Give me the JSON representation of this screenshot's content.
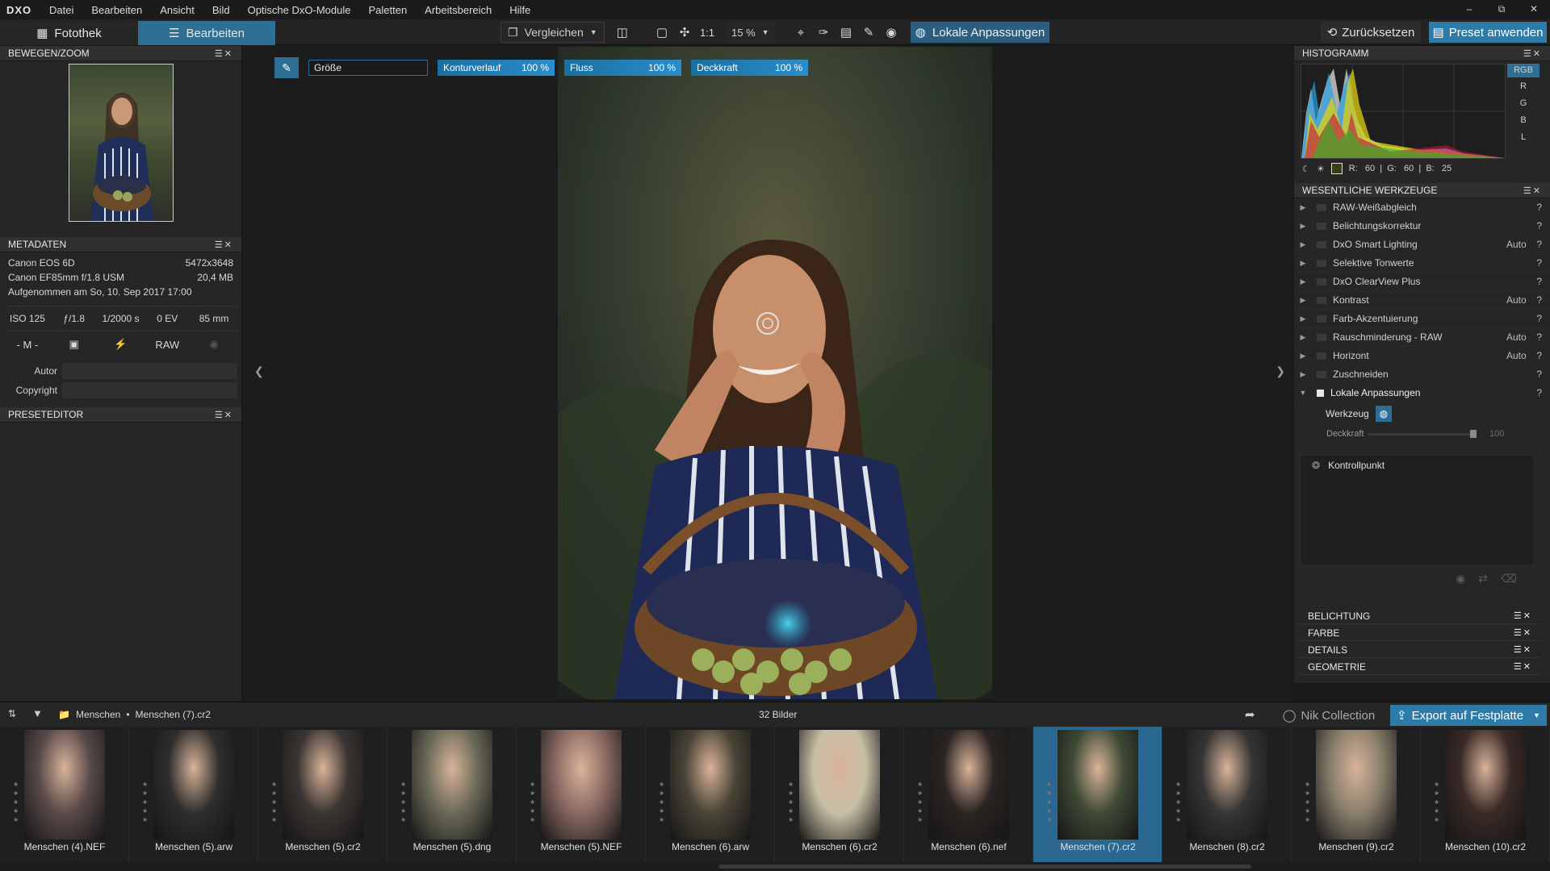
{
  "app": {
    "logo": "DXO"
  },
  "menu": [
    "Datei",
    "Bearbeiten",
    "Ansicht",
    "Bild",
    "Optische DxO-Module",
    "Paletten",
    "Arbeitsbereich",
    "Hilfe"
  ],
  "toolbar": {
    "tab_library": "Fotothek",
    "tab_edit": "Bearbeiten",
    "compare": "Vergleichen",
    "one_to_one": "1:1",
    "zoom": "15 %",
    "local_adjust": "Lokale Anpassungen",
    "reset": "Zurücksetzen",
    "apply_preset": "Preset anwenden"
  },
  "left": {
    "move_zoom_title": "BEWEGEN/ZOOM",
    "metadata_title": "METADATEN",
    "camera": "Canon EOS 6D",
    "resolution": "5472x3648",
    "lens": "Canon EF85mm f/1.8 USM",
    "filesize": "20,4 MB",
    "date": "Aufgenommen am So, 10. Sep 2017 17:00",
    "exif": [
      "ISO 125",
      "ƒ/1.8",
      "1/2000 s",
      "0 EV",
      "85 mm"
    ],
    "mode": "- M -",
    "raw": "RAW",
    "author_label": "Autor",
    "copyright_label": "Copyright",
    "preset_editor_title": "PRESETEDITOR"
  },
  "lokal_bar": {
    "size_label": "Größe",
    "sliders": [
      {
        "label": "Konturverlauf",
        "value": "100 %"
      },
      {
        "label": "Fluss",
        "value": "100 %"
      },
      {
        "label": "Deckkraft",
        "value": "100 %"
      }
    ]
  },
  "right": {
    "histogram_title": "HISTOGRAMM",
    "channels": [
      "RGB",
      "R",
      "G",
      "B",
      "L"
    ],
    "rgb_readout": "R:   60  |  G:   60  |  B:   25",
    "tools_title": "WESENTLICHE WERKZEUGE",
    "tools": [
      {
        "name": "RAW-Weißabgleich",
        "auto": "",
        "q": "?"
      },
      {
        "name": "Belichtungskorrektur",
        "auto": "",
        "q": "?"
      },
      {
        "name": "DxO Smart Lighting",
        "auto": "Auto",
        "q": "?"
      },
      {
        "name": "Selektive Tonwerte",
        "auto": "",
        "q": "?"
      },
      {
        "name": "DxO ClearView Plus",
        "auto": "",
        "q": "?"
      },
      {
        "name": "Kontrast",
        "auto": "Auto",
        "q": "?"
      },
      {
        "name": "Farb-Akzentuierung",
        "auto": "",
        "q": "?"
      },
      {
        "name": "Rauschminderung - RAW",
        "auto": "Auto",
        "q": "?"
      },
      {
        "name": "Horizont",
        "auto": "Auto",
        "q": "?"
      },
      {
        "name": "Zuschneiden",
        "auto": "",
        "q": "?"
      },
      {
        "name": "Lokale Anpassungen",
        "auto": "",
        "q": "?"
      }
    ],
    "werkzeug_label": "Werkzeug",
    "deckkraft_label": "Deckkraft",
    "deckkraft_value": "100",
    "kontrollpunkt": "Kontrollpunkt",
    "sections": [
      "BELICHTUNG",
      "FARBE",
      "DETAILS",
      "GEOMETRIE"
    ]
  },
  "filmstrip_bar": {
    "folder": "Menschen",
    "separator": "•",
    "file": "Menschen (7).cr2",
    "count": "32 Bilder",
    "nik": "Nik Collection",
    "export": "Export auf Festplatte"
  },
  "filmstrip": [
    {
      "name": "Menschen (4).NEF",
      "tone": "#5a4a4a"
    },
    {
      "name": "Menschen (5).arw",
      "tone": "#2e2e2e"
    },
    {
      "name": "Menschen (5).cr2",
      "tone": "#3a3532"
    },
    {
      "name": "Menschen (5).dng",
      "tone": "#6b6a58"
    },
    {
      "name": "Menschen (5).NEF",
      "tone": "#8a6a62"
    },
    {
      "name": "Menschen (6).arw",
      "tone": "#4a4436"
    },
    {
      "name": "Menschen (6).cr2",
      "tone": "#c8bfa6"
    },
    {
      "name": "Menschen (6).nef",
      "tone": "#2a2422"
    },
    {
      "name": "Menschen (7).cr2",
      "tone": "#3f4a35",
      "selected": true
    },
    {
      "name": "Menschen (8).cr2",
      "tone": "#353535"
    },
    {
      "name": "Menschen (9).cr2",
      "tone": "#8a7f6c"
    },
    {
      "name": "Menschen (10).cr2",
      "tone": "#3a2a26"
    }
  ]
}
